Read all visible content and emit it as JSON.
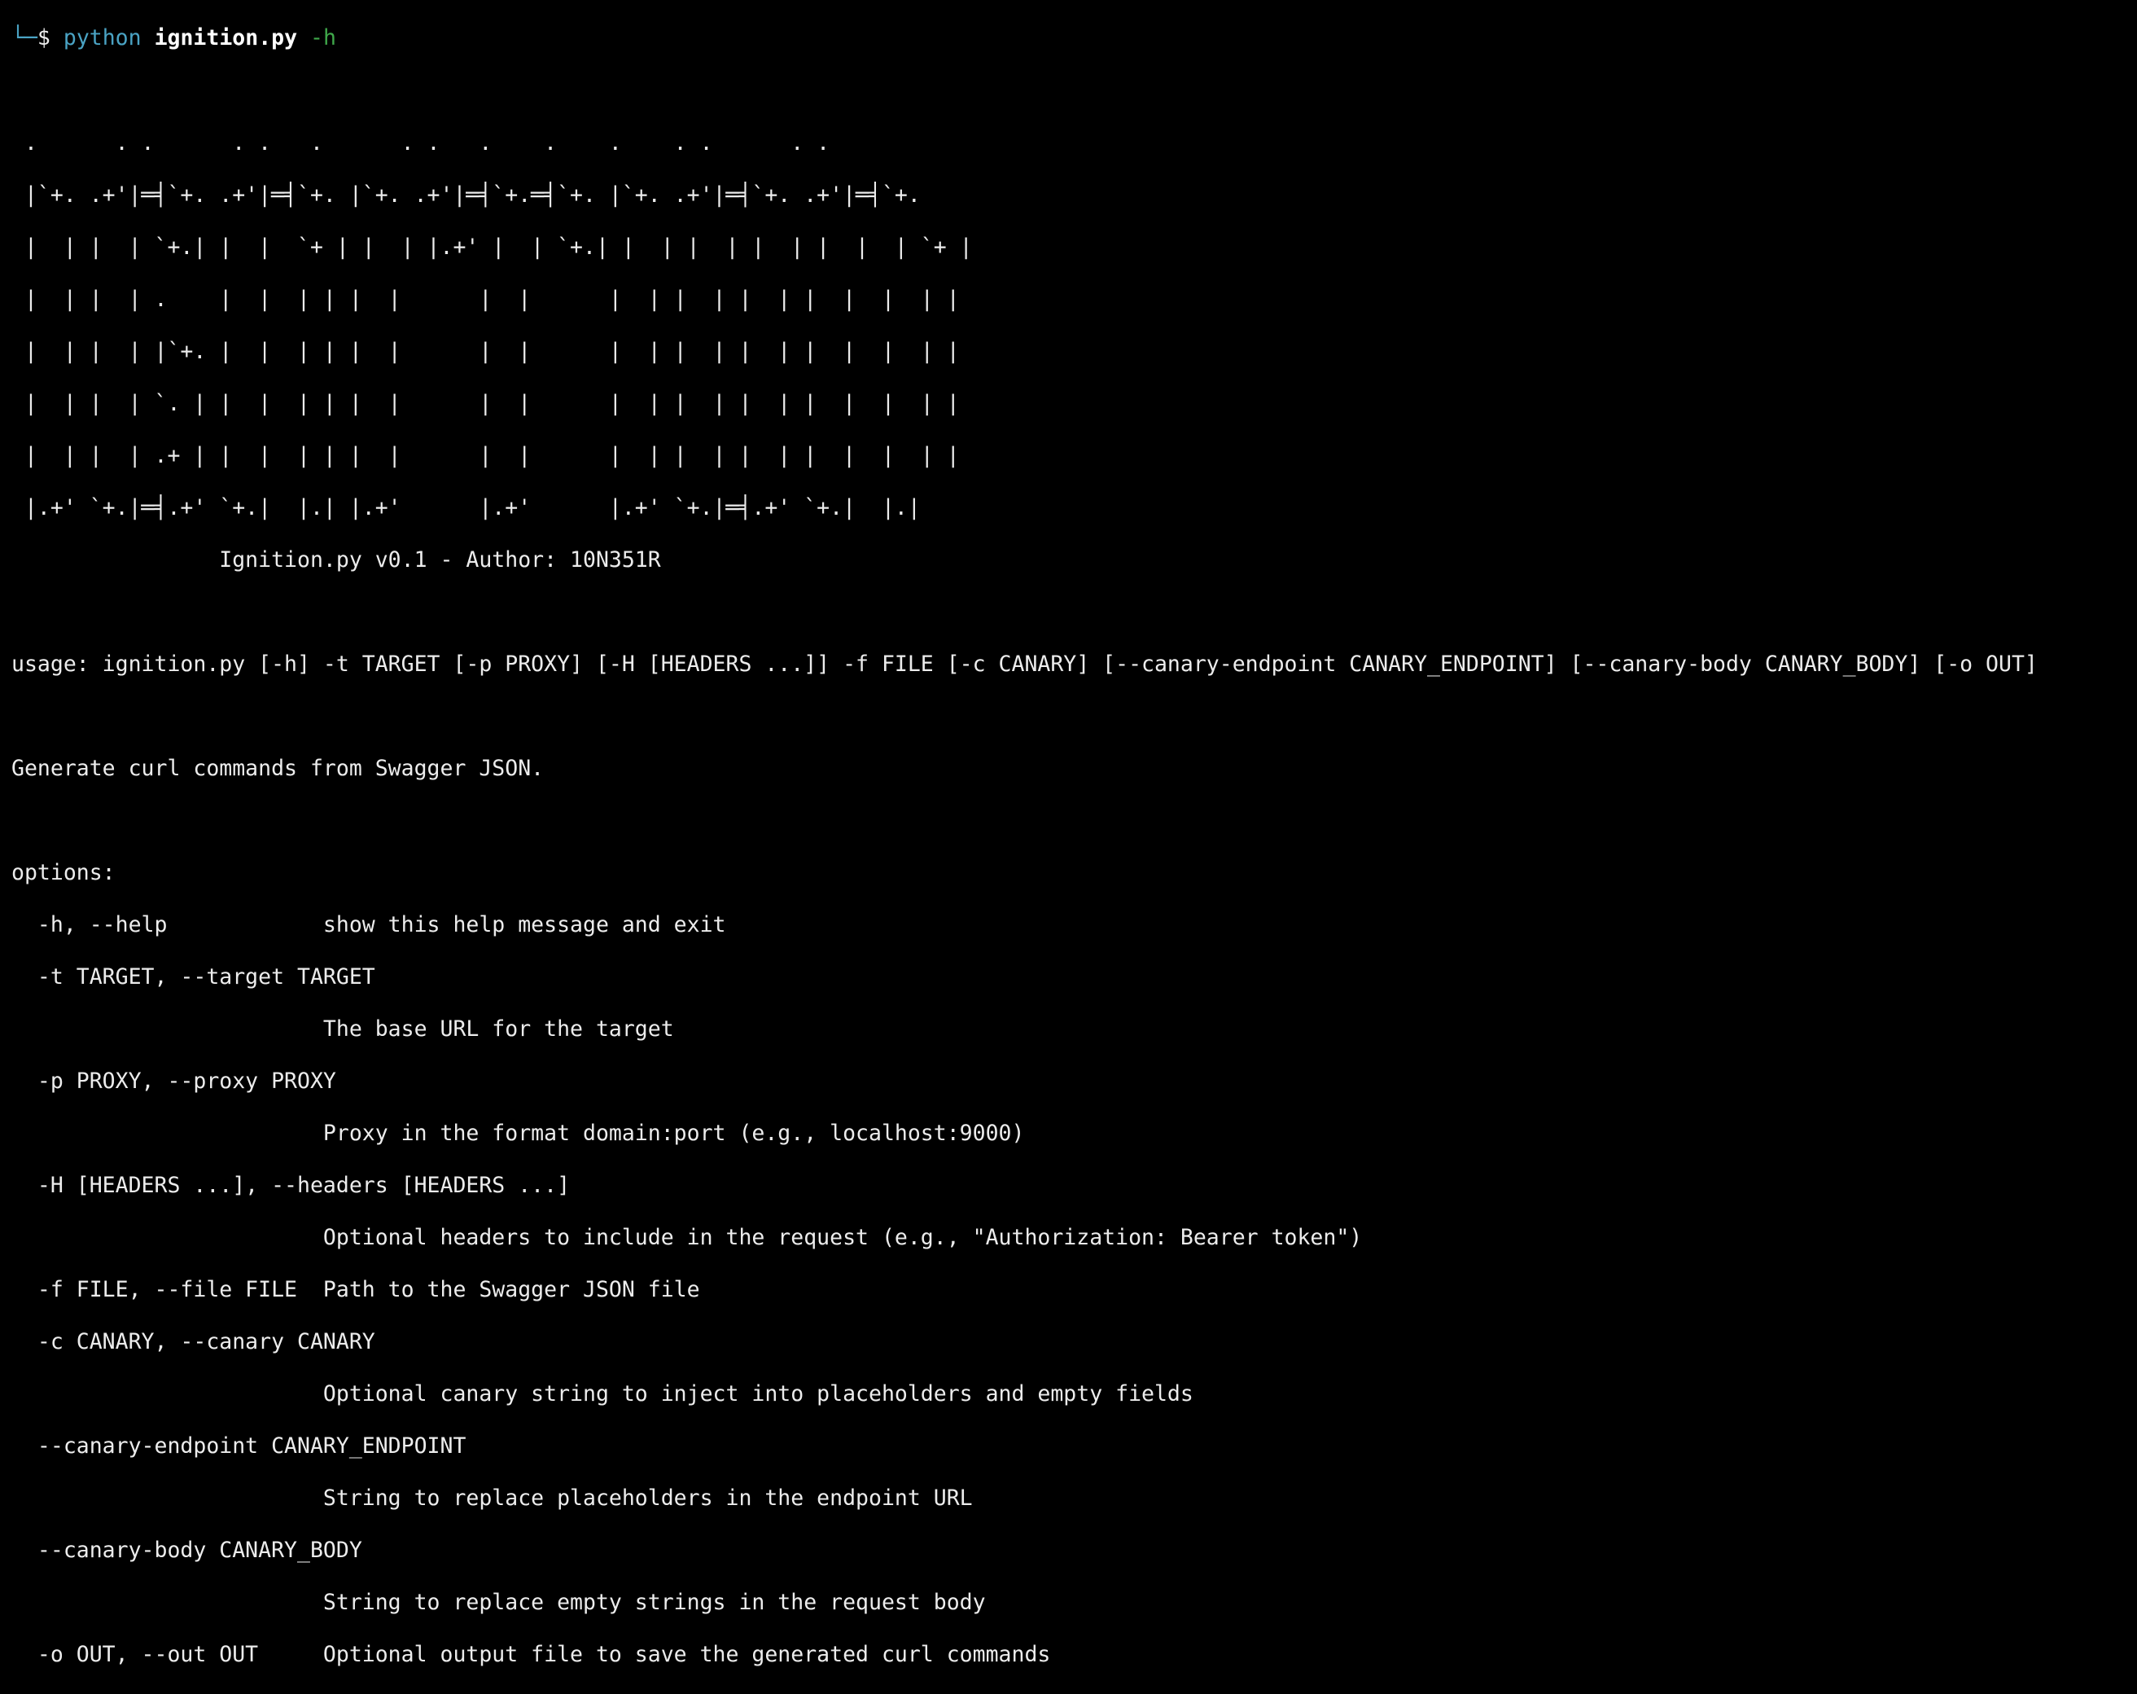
{
  "prompt": {
    "tree": "└─",
    "dollar": "$",
    "command": "python",
    "script": "ignition.py",
    "flag": "-h"
  },
  "banner": [
    " .      . .      . .   .      . .   .    .    .    . .      . .",
    " |`+. .+'|═╡`+. .+'|═╡`+. |`+. .+'|═╡`+.═╡`+. |`+. .+'|═╡`+. .+'|═╡`+.",
    " |  | |  | `+.| |  |  `+ | |  | |.+' |  | `+.| |  | |  | |  | |  |  | `+ |",
    " |  | |  | .    |  |  | | |  |      |  |      |  | |  | |  | |  |  |  | |",
    " |  | |  | |`+. |  |  | | |  |      |  |      |  | |  | |  | |  |  |  | |",
    " |  | |  | `. | |  |  | | |  |      |  |      |  | |  | |  | |  |  |  | |",
    " |  | |  | .+ | |  |  | | |  |      |  |      |  | |  | |  | |  |  |  | |",
    " |.+' `+.|═╡.+' `+.|  |.| |.+'      |.+'      |.+' `+.|═╡.+' `+.|  |.|"
  ],
  "banner_credit": "                Ignition.py v0.1 - Author: 10N351R",
  "usage": "usage: ignition.py [-h] -t TARGET [-p PROXY] [-H [HEADERS ...]] -f FILE [-c CANARY] [--canary-endpoint CANARY_ENDPOINT] [--canary-body CANARY_BODY] [-o OUT]",
  "description": "Generate curl commands from Swagger JSON.",
  "options_header": "options:",
  "options": [
    "  -h, --help            show this help message and exit",
    "  -t TARGET, --target TARGET",
    "                        The base URL for the target",
    "  -p PROXY, --proxy PROXY",
    "                        Proxy in the format domain:port (e.g., localhost:9000)",
    "  -H [HEADERS ...], --headers [HEADERS ...]",
    "                        Optional headers to include in the request (e.g., \"Authorization: Bearer token\")",
    "  -f FILE, --file FILE  Path to the Swagger JSON file",
    "  -c CANARY, --canary CANARY",
    "                        Optional canary string to inject into placeholders and empty fields",
    "  --canary-endpoint CANARY_ENDPOINT",
    "                        String to replace placeholders in the endpoint URL",
    "  --canary-body CANARY_BODY",
    "                        String to replace empty strings in the request body",
    "  -o OUT, --out OUT     Optional output file to save the generated curl commands"
  ],
  "colors": {
    "background": "#000000",
    "text": "#ececec",
    "prompt_accent": "#4aa3c4",
    "flag": "#3fa84a"
  }
}
